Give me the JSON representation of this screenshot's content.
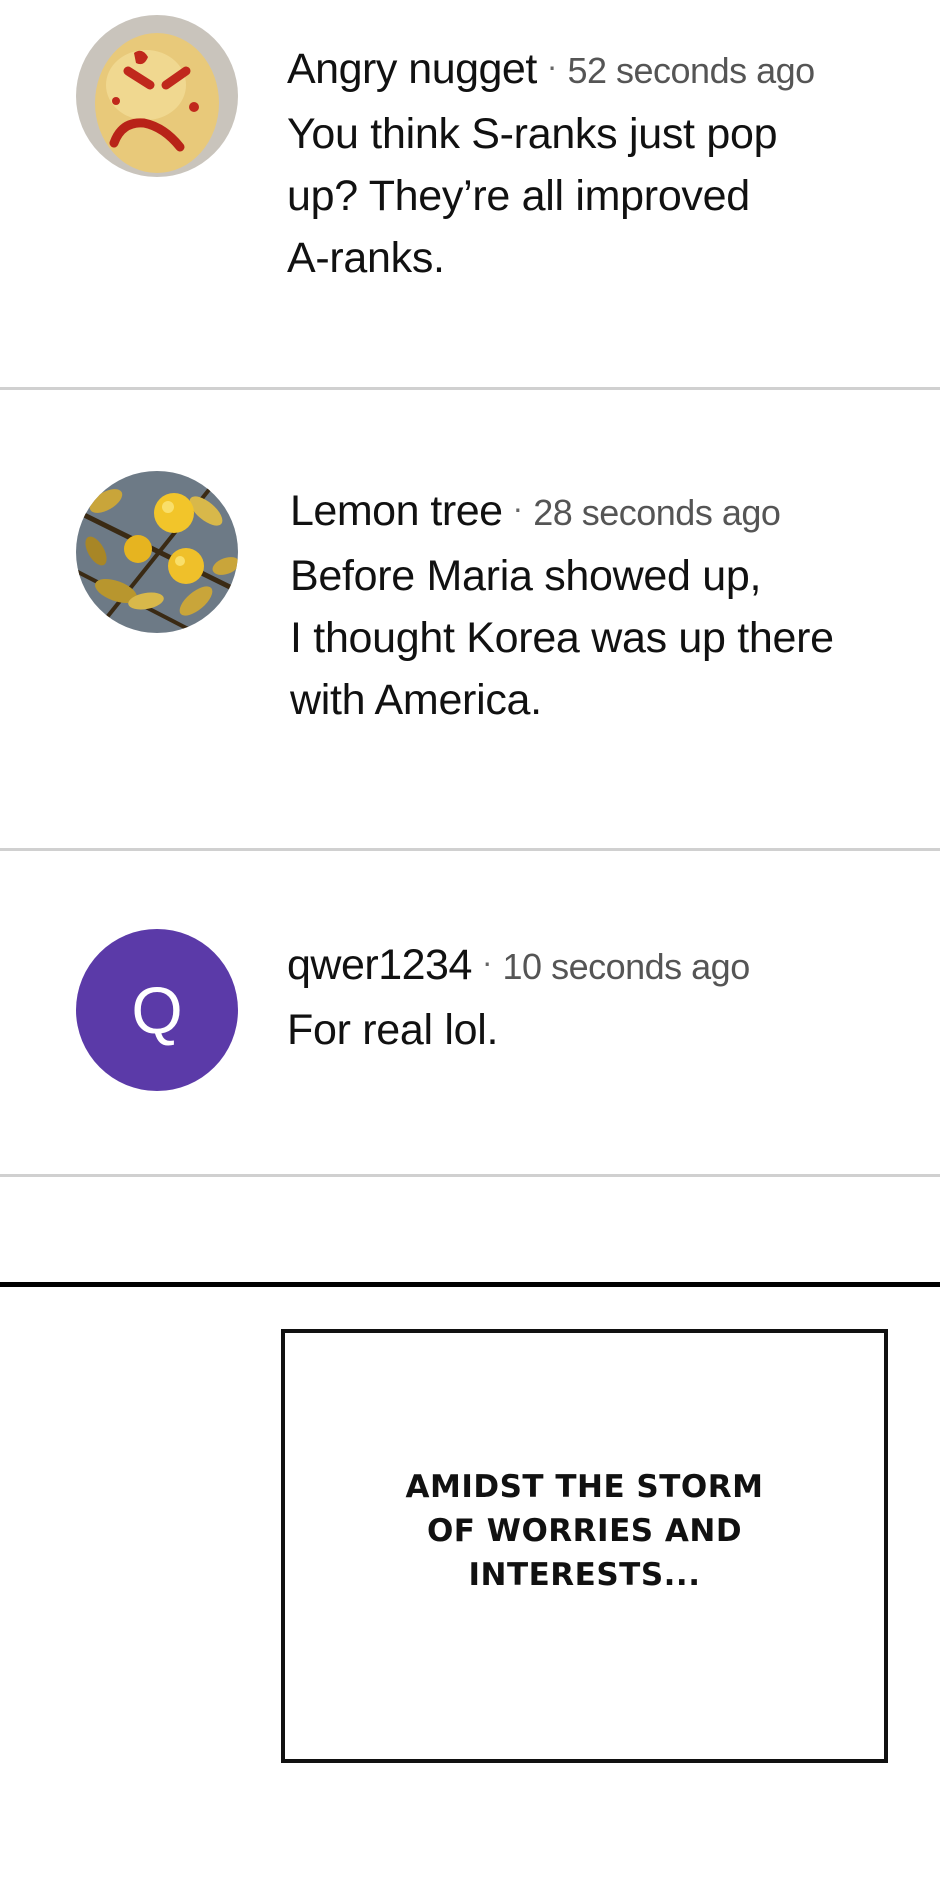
{
  "comments": [
    {
      "username": "Angry nugget",
      "timestamp": "52 seconds ago",
      "separator": "·",
      "lines": [
        "You think S-ranks just pop",
        "up? They’re all improved",
        "A-ranks."
      ],
      "avatar": {
        "type": "image",
        "icon": "angry-nugget-icon"
      }
    },
    {
      "username": "Lemon tree",
      "timestamp": "28 seconds ago",
      "separator": "·",
      "lines": [
        "Before Maria showed up,",
        "I thought Korea was up there",
        "with America."
      ],
      "avatar": {
        "type": "image",
        "icon": "lemon-tree-icon"
      }
    },
    {
      "username": "qwer1234",
      "timestamp": "10 seconds ago",
      "separator": "·",
      "lines": [
        "For real lol."
      ],
      "avatar": {
        "type": "letter",
        "letter": "Q",
        "color": "#5b3aa8"
      }
    }
  ],
  "caption": {
    "lines": [
      "AMIDST THE STORM",
      "OF WORRIES AND",
      "INTERESTS..."
    ]
  }
}
